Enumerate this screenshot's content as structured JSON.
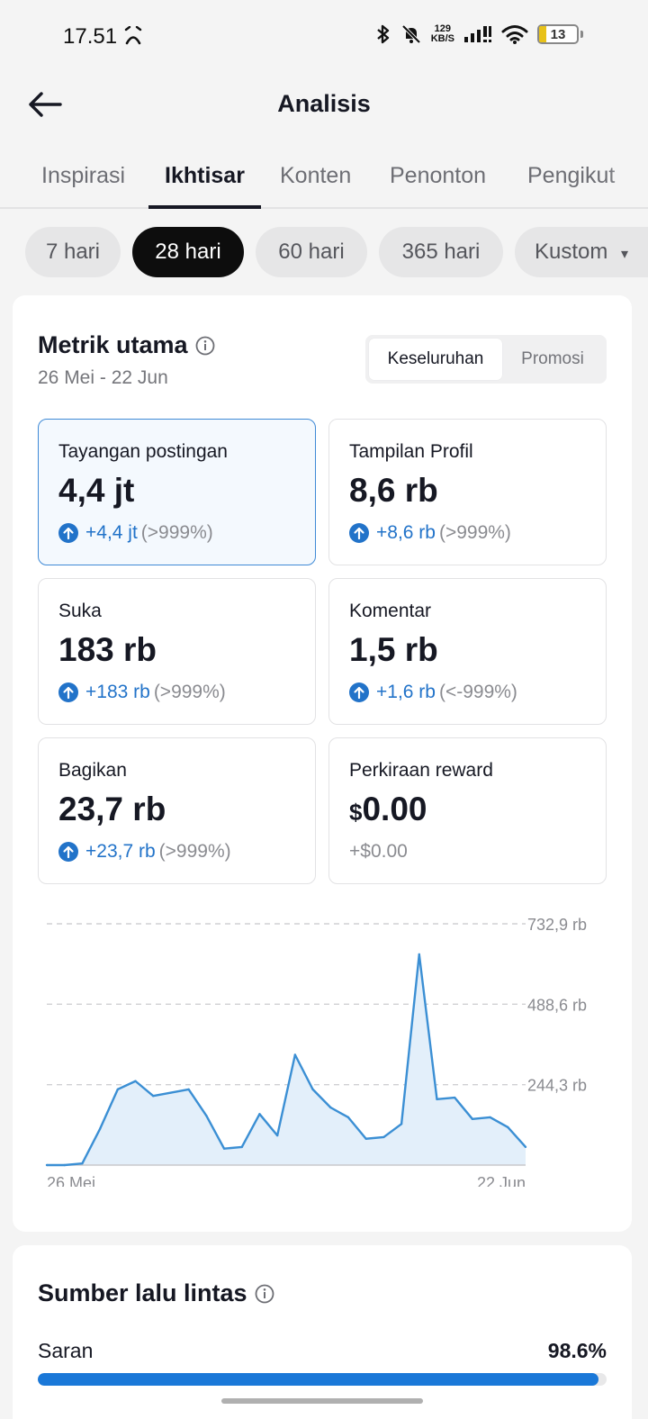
{
  "status_bar": {
    "time": "17.51",
    "net_speed_value": "129",
    "net_speed_unit": "KB/S",
    "battery": "13"
  },
  "header": {
    "title": "Analisis"
  },
  "tabs": [
    {
      "label": "Inspirasi",
      "active": false
    },
    {
      "label": "Ikhtisar",
      "active": true
    },
    {
      "label": "Konten",
      "active": false
    },
    {
      "label": "Penonton",
      "active": false
    },
    {
      "label": "Pengikut",
      "active": false
    }
  ],
  "range_chips": [
    {
      "label": "7 hari",
      "active": false
    },
    {
      "label": "28 hari",
      "active": true
    },
    {
      "label": "60 hari",
      "active": false
    },
    {
      "label": "365 hari",
      "active": false
    },
    {
      "label": "Kustom",
      "active": false
    }
  ],
  "metrics": {
    "title": "Metrik utama",
    "date_range": "26 Mei - 22 Jun",
    "segments": [
      {
        "label": "Keseluruhan",
        "active": true
      },
      {
        "label": "Promosi",
        "active": false
      }
    ],
    "tiles": [
      {
        "label": "Tayangan postingan",
        "value": "4,4 jt",
        "delta": "+4,4 jt",
        "pct": "(>999%)",
        "active": true
      },
      {
        "label": "Tampilan Profil",
        "value": "8,6 rb",
        "delta": "+8,6 rb",
        "pct": "(>999%)",
        "active": false
      },
      {
        "label": "Suka",
        "value": "183 rb",
        "delta": "+183 rb",
        "pct": "(>999%)",
        "active": false
      },
      {
        "label": "Komentar",
        "value": "1,5 rb",
        "delta": "+1,6 rb",
        "pct": "(<-999%)",
        "active": false
      },
      {
        "label": "Bagikan",
        "value": "23,7 rb",
        "delta": "+23,7 rb",
        "pct": "(>999%)",
        "active": false
      },
      {
        "label": "Perkiraan reward",
        "currency": "$",
        "value": "0.00",
        "delta": "+$0.00",
        "pct": "",
        "active": false
      }
    ]
  },
  "chart_data": {
    "type": "area",
    "x_start_label": "26 Mei",
    "x_end_label": "22 Jun",
    "y_ticks": [
      {
        "value": 244300,
        "label": "244,3 rb"
      },
      {
        "value": 488600,
        "label": "488,6 rb"
      },
      {
        "value": 732900,
        "label": "732,9 rb"
      }
    ],
    "ylim": [
      0,
      732900
    ],
    "grid": true,
    "values": [
      0,
      0,
      5000,
      110000,
      230000,
      255000,
      210000,
      220000,
      230000,
      150000,
      50000,
      55000,
      155000,
      90000,
      335000,
      230000,
      175000,
      145000,
      80000,
      85000,
      125000,
      640000,
      200000,
      205000,
      140000,
      145000,
      115000,
      55000
    ],
    "line_color": "#3b8fd4",
    "fill_color": "#e3effa"
  },
  "traffic": {
    "title": "Sumber lalu lintas",
    "rows": [
      {
        "label": "Saran",
        "value": "98.6%",
        "fraction": 0.986
      }
    ]
  }
}
